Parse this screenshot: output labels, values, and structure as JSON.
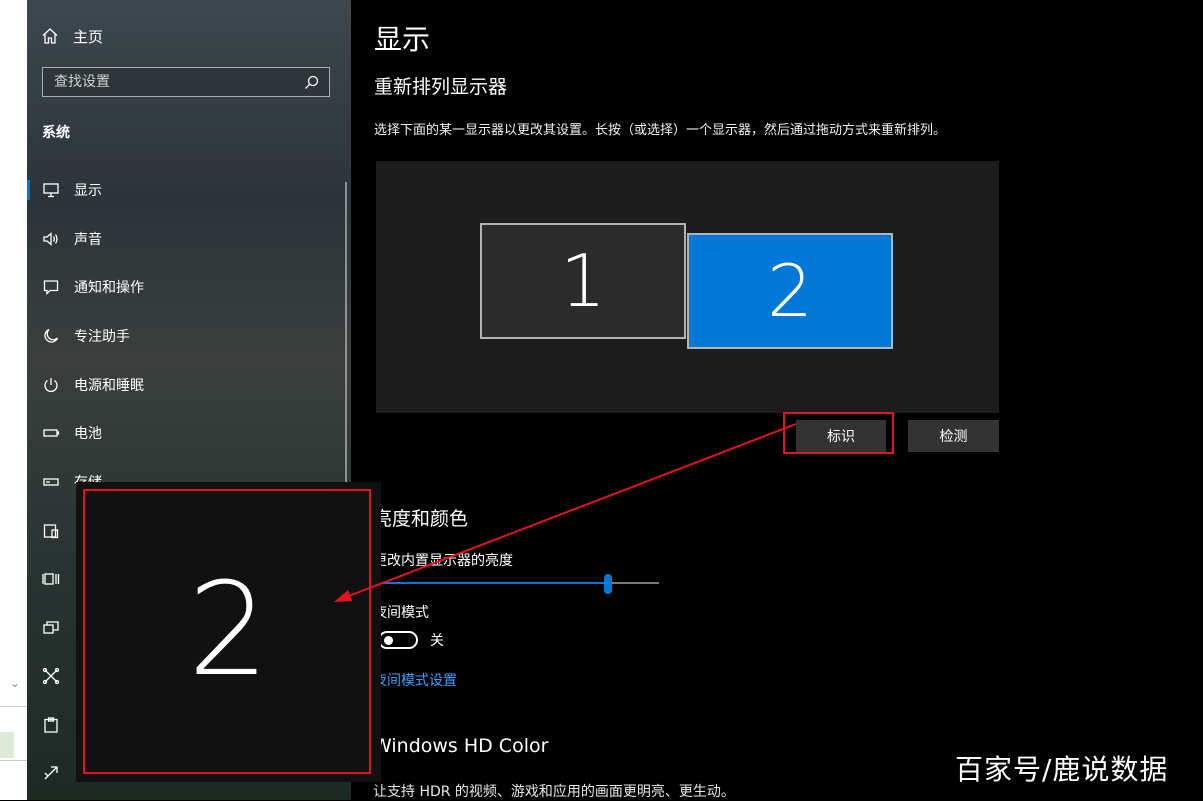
{
  "sidebar": {
    "home_label": "主页",
    "search_placeholder": "查找设置",
    "section": "系统",
    "items": [
      {
        "label": "显示",
        "icon": "monitor-icon"
      },
      {
        "label": "声音",
        "icon": "speaker-icon"
      },
      {
        "label": "通知和操作",
        "icon": "notification-icon"
      },
      {
        "label": "专注助手",
        "icon": "moon-icon"
      },
      {
        "label": "电源和睡眠",
        "icon": "power-icon"
      },
      {
        "label": "电池",
        "icon": "battery-icon"
      },
      {
        "label": "存储",
        "icon": "storage-icon"
      }
    ],
    "partial_icons": [
      "tablet-icon",
      "multitask-icon",
      "project-icon",
      "shared-icon",
      "clipboard-icon",
      "remote-icon"
    ]
  },
  "main": {
    "title": "显示",
    "arrange": {
      "heading": "重新排列显示器",
      "description": "选择下面的某一显示器以更改其设置。长按（或选择）一个显示器，然后通过拖动方式来重新排列。",
      "monitors": [
        {
          "label": "1"
        },
        {
          "label": "2"
        }
      ],
      "identify_label": "标识",
      "detect_label": "检测"
    },
    "brightness": {
      "heading": "亮度和颜色",
      "slider_label": "更改内置显示器的亮度",
      "slider_value": 0.82,
      "night_label": "夜间模式",
      "night_state": "关",
      "night_link": "夜间模式设置"
    },
    "hdr": {
      "heading": "Windows HD Color",
      "description": "让支持 HDR 的视频、游戏和应用的画面更明亮、更生动。"
    }
  },
  "overlay": {
    "number": "2"
  },
  "watermark": "百家号/鹿说数据",
  "colors": {
    "accent": "#0078d7",
    "highlight": "#e81123",
    "link": "#3aa0ff"
  }
}
